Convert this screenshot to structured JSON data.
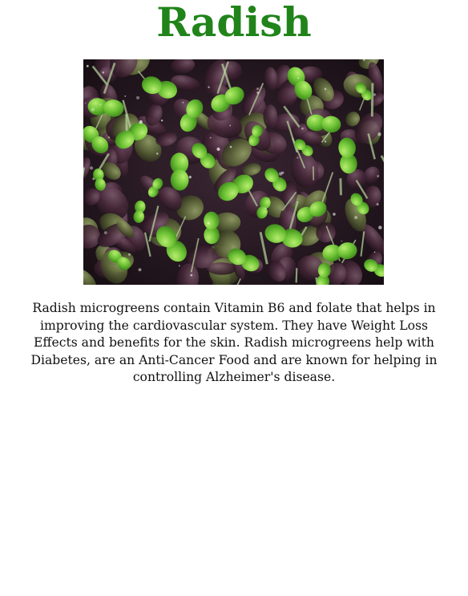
{
  "title": "Radish",
  "image": {
    "subject": "radish-microgreens-photo",
    "colors": {
      "leaf_green": "#6fc637",
      "leaf_light": "#9fe05a",
      "leaf_purple": "#4a2a3c",
      "leaf_dark": "#1c1218",
      "stem": "#b9d7a0"
    }
  },
  "description": "Radish microgreens contain Vitamin B6 and folate that helps in improving the cardiovascular system. They have Weight Loss Effects and benefits for the skin. Radish microgreens help with Diabetes, are an Anti-Cancer Food and are known for helping in controlling Alzheimer's disease."
}
